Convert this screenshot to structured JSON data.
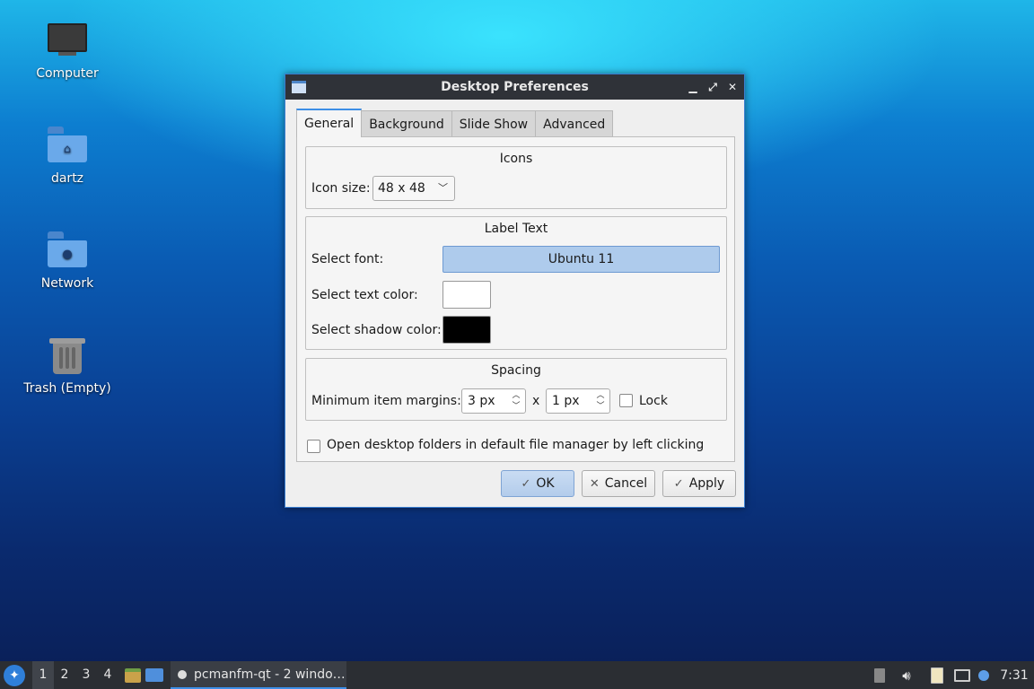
{
  "desktop": {
    "icons": [
      {
        "label": "Computer"
      },
      {
        "label": "dartz"
      },
      {
        "label": "Network"
      },
      {
        "label": "Trash (Empty)"
      }
    ]
  },
  "dialog": {
    "title": "Desktop Preferences",
    "tabs": [
      {
        "label": "General"
      },
      {
        "label": "Background"
      },
      {
        "label": "Slide Show"
      },
      {
        "label": "Advanced"
      }
    ],
    "icons_group": {
      "title": "Icons",
      "icon_size_label": "Icon size:",
      "icon_size_value": "48 x 48"
    },
    "label_text_group": {
      "title": "Label Text",
      "font_label": "Select font:",
      "font_value": "Ubuntu 11",
      "text_color_label": "Select text color:",
      "text_color": "#ffffff",
      "shadow_color_label": "Select shadow color:",
      "shadow_color": "#000000"
    },
    "spacing_group": {
      "title": "Spacing",
      "margins_label": "Minimum item margins:",
      "margin_x": "3 px",
      "separator": "x",
      "margin_y": "1 px",
      "lock_label": "Lock"
    },
    "open_folders_label": "Open desktop folders in default file manager by left clicking",
    "buttons": {
      "ok": "OK",
      "cancel": "Cancel",
      "apply": "Apply"
    }
  },
  "taskbar": {
    "workspaces": [
      "1",
      "2",
      "3",
      "4"
    ],
    "task_label": "pcmanfm-qt - 2 windo…",
    "clock": "7:31"
  }
}
